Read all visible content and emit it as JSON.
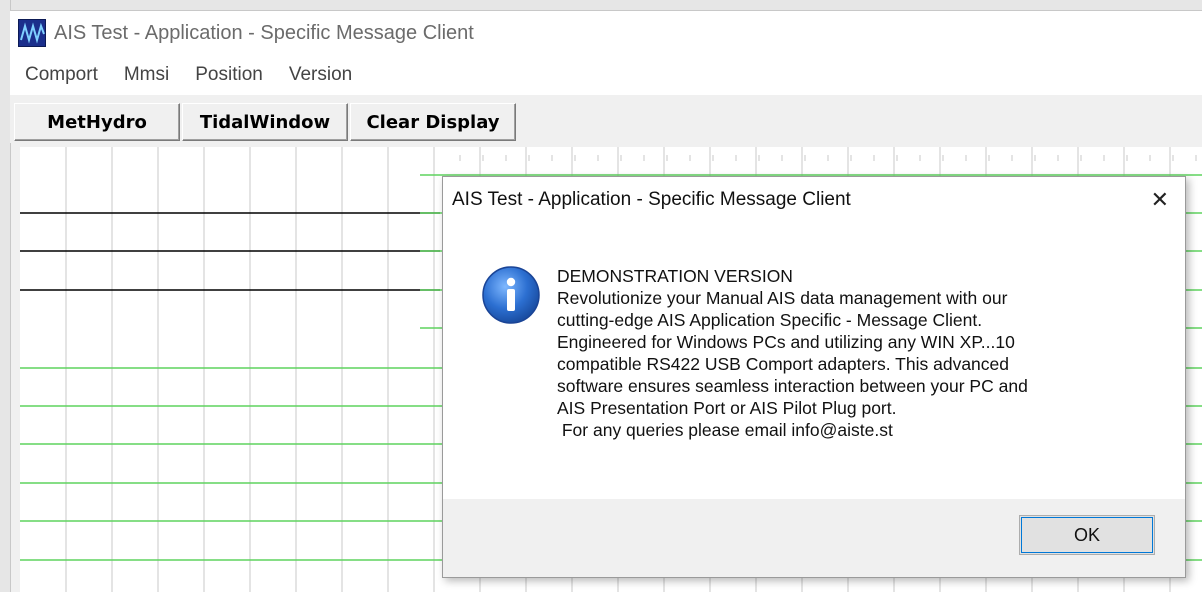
{
  "window": {
    "title": "AIS Test - Application - Specific Message Client"
  },
  "menu": {
    "items": [
      "Comport",
      "Mmsi",
      "Position",
      "Version"
    ]
  },
  "toolbar": {
    "buttons": [
      "MetHydro",
      "TidalWindow",
      "Clear Display"
    ]
  },
  "dialog": {
    "title": "AIS Test - Application - Specific Message Client",
    "close_label": "✕",
    "lines": [
      "DEMONSTRATION VERSION",
      "Revolutionize your Manual AIS data management with our",
      "cutting-edge AIS Application Specific - Message Client.",
      "Engineered for Windows PCs and utilizing any WIN XP...10",
      "compatible RS422 USB Comport adapters. This advanced",
      "software ensures seamless interaction between your PC and",
      "AIS Presentation Port or AIS Pilot Plug port.",
      " For any queries please email info@aiste.st"
    ],
    "ok_label": "OK",
    "icon": "info-icon"
  },
  "colors": {
    "grid_gray": "#c8c8c8",
    "trace_black": "#000000",
    "trace_green": "#5fd35f",
    "app_icon_blue": "#1b2f8c",
    "focus_blue": "#0078d7"
  }
}
